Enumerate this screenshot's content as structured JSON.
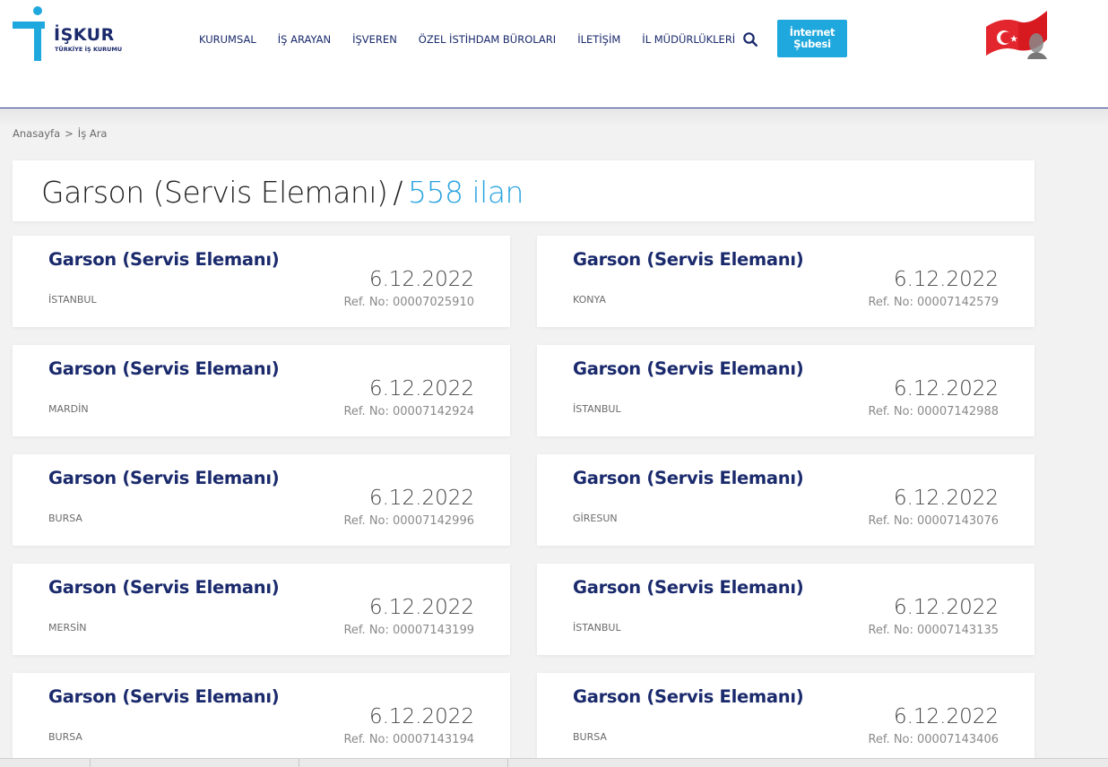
{
  "brand": {
    "name": "İŞKUR",
    "subtitle": "TÜRKİYE İŞ KURUMU",
    "primary_color": "#1a2a6c",
    "accent_color": "#1fa8dd"
  },
  "nav": {
    "items": [
      "KURUMSAL",
      "İŞ ARAYAN",
      "İŞVEREN",
      "ÖZEL İSTİHDAM BÜROLARI",
      "İLETİŞİM",
      "İL MÜDÜRLÜKLERİ"
    ],
    "search_icon": "search-icon",
    "internet_button_line1": "İnternet",
    "internet_button_line2": "Şubesi"
  },
  "breadcrumb": {
    "home": "Anasayfa",
    "separator": ">",
    "current": "İş Ara"
  },
  "heading": {
    "job_title": "Garson (Servis Elemanı)",
    "separator": "/",
    "count": "558 ilan"
  },
  "listings": [
    {
      "title": "Garson (Servis Elemanı)",
      "city": "İSTANBUL",
      "date": "6.12.2022",
      "ref": "Ref. No: 00007025910"
    },
    {
      "title": "Garson (Servis Elemanı)",
      "city": "KONYA",
      "date": "6.12.2022",
      "ref": "Ref. No: 00007142579"
    },
    {
      "title": "Garson (Servis Elemanı)",
      "city": "MARDİN",
      "date": "6.12.2022",
      "ref": "Ref. No: 00007142924"
    },
    {
      "title": "Garson (Servis Elemanı)",
      "city": "İSTANBUL",
      "date": "6.12.2022",
      "ref": "Ref. No: 00007142988"
    },
    {
      "title": "Garson (Servis Elemanı)",
      "city": "BURSA",
      "date": "6.12.2022",
      "ref": "Ref. No: 00007142996"
    },
    {
      "title": "Garson (Servis Elemanı)",
      "city": "GİRESUN",
      "date": "6.12.2022",
      "ref": "Ref. No: 00007143076"
    },
    {
      "title": "Garson (Servis Elemanı)",
      "city": "MERSİN",
      "date": "6.12.2022",
      "ref": "Ref. No: 00007143199"
    },
    {
      "title": "Garson (Servis Elemanı)",
      "city": "İSTANBUL",
      "date": "6.12.2022",
      "ref": "Ref. No: 00007143135"
    },
    {
      "title": "Garson (Servis Elemanı)",
      "city": "BURSA",
      "date": "6.12.2022",
      "ref": "Ref. No: 00007143194"
    },
    {
      "title": "Garson (Servis Elemanı)",
      "city": "BURSA",
      "date": "6.12.2022",
      "ref": "Ref. No: 00007143406"
    }
  ]
}
